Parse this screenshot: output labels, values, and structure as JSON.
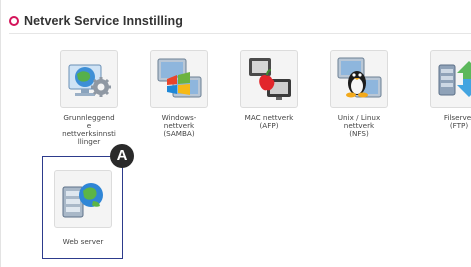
{
  "section": {
    "title": "Netverk Service Innstilling",
    "accent_color": "#d4145a"
  },
  "items": [
    {
      "label": "Grunnleggend\ne\nnettverksinnsti\nllinger",
      "icon": "network-settings-icon"
    },
    {
      "label": "Windows-\nnettverk\n(SAMBA)",
      "icon": "windows-network-icon"
    },
    {
      "label": "MAC nettverk\n(AFP)",
      "icon": "mac-network-icon"
    },
    {
      "label": "Unix / Linux\nnettverk\n(NFS)",
      "icon": "linux-network-icon"
    },
    {
      "label": "Filserver\n(FTP)",
      "icon": "ftp-server-icon"
    },
    {
      "label": "Web server",
      "icon": "web-server-icon"
    }
  ],
  "callout": {
    "label": "A",
    "color": "#2d3b8c"
  }
}
